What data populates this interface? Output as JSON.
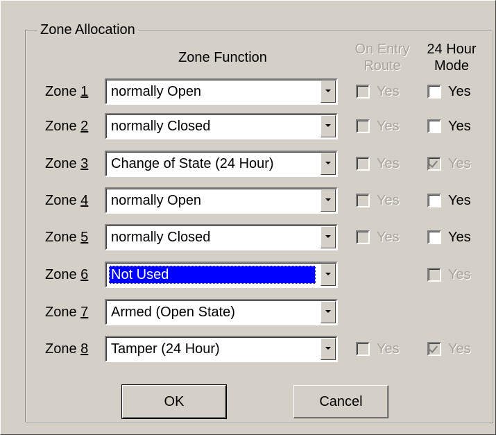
{
  "group_title": "Zone Allocation",
  "headers": {
    "zone_function": "Zone Function",
    "on_entry_line1": "On Entry",
    "on_entry_line2": "Route",
    "mode_line1": "24 Hour",
    "mode_line2": "Mode"
  },
  "zones": [
    {
      "prefix": "Zone ",
      "num": "1",
      "function": "normally Open",
      "entry_label": "Yes",
      "mode_label": "Yes"
    },
    {
      "prefix": "Zone ",
      "num": "2",
      "function": "normally Closed",
      "entry_label": "Yes",
      "mode_label": "Yes"
    },
    {
      "prefix": "Zone ",
      "num": "3",
      "function": "Change of State (24 Hour)",
      "entry_label": "Yes",
      "mode_label": "Yes"
    },
    {
      "prefix": "Zone ",
      "num": "4",
      "function": "normally Open",
      "entry_label": "Yes",
      "mode_label": "Yes"
    },
    {
      "prefix": "Zone ",
      "num": "5",
      "function": "normally Closed",
      "entry_label": "Yes",
      "mode_label": "Yes"
    },
    {
      "prefix": "Zone ",
      "num": "6",
      "function": "Not Used",
      "mode_label": "Yes"
    },
    {
      "prefix": "Zone ",
      "num": "7",
      "function": "Armed (Open State)"
    },
    {
      "prefix": "Zone ",
      "num": "8",
      "function": "Tamper (24 Hour)",
      "entry_label": "Yes",
      "mode_label": "Yes"
    }
  ],
  "checkbox_states": {
    "on_entry": [
      "disabled-unchecked",
      "disabled-unchecked",
      "disabled-unchecked",
      "disabled-unchecked",
      "disabled-unchecked",
      "hidden",
      "hidden",
      "disabled-unchecked"
    ],
    "mode_24h": [
      "unchecked",
      "unchecked",
      "disabled-checked",
      "unchecked",
      "unchecked",
      "disabled-unchecked",
      "hidden",
      "disabled-checked"
    ]
  },
  "selected_zone": "6",
  "buttons": {
    "ok": "OK",
    "cancel": "Cancel"
  },
  "colors": {
    "dialog_bg": "#d4d0c8",
    "selection": "#0000ff",
    "disabled_text": "#a7a39b"
  }
}
